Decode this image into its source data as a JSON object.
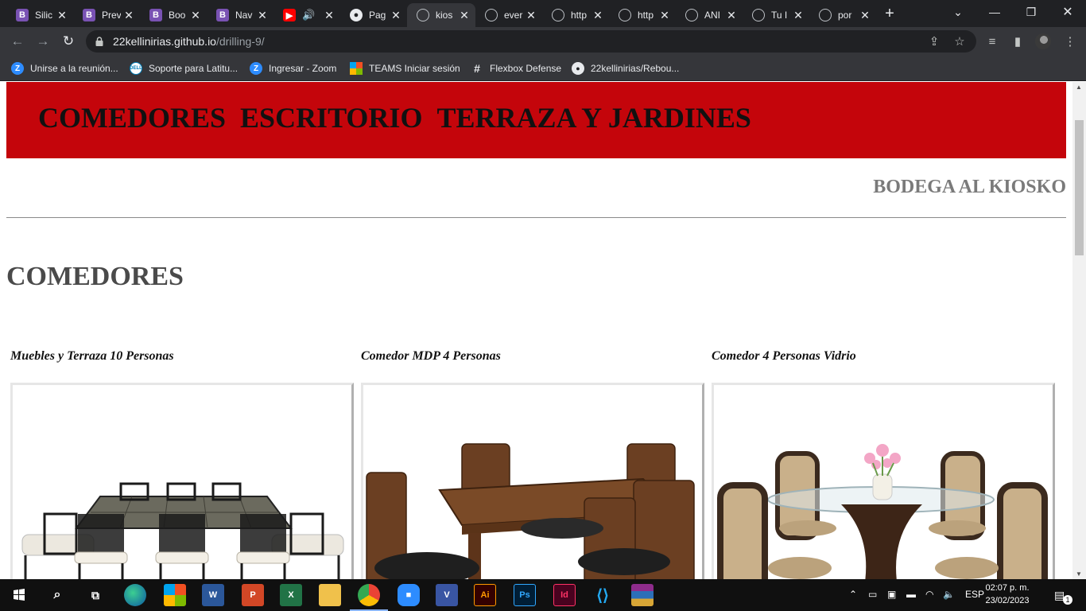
{
  "browser": {
    "tabs": [
      {
        "title": "Silic",
        "icon": "bootstrap-icon"
      },
      {
        "title": "Prev",
        "icon": "bootstrap-icon"
      },
      {
        "title": "Boo",
        "icon": "bootstrap-icon"
      },
      {
        "title": "Nav",
        "icon": "bootstrap-icon"
      },
      {
        "title": "",
        "icon": "youtube-icon",
        "audio": true
      },
      {
        "title": "Pag",
        "icon": "github-icon"
      },
      {
        "title": "kios",
        "icon": "globe-icon",
        "active": true
      },
      {
        "title": "ever",
        "icon": "globe-icon"
      },
      {
        "title": "http",
        "icon": "globe-icon"
      },
      {
        "title": "http",
        "icon": "globe-icon"
      },
      {
        "title": "ANI",
        "icon": "globe-icon"
      },
      {
        "title": "Tu I",
        "icon": "globe-icon"
      },
      {
        "title": "por",
        "icon": "globe-icon"
      }
    ],
    "url_host": "22kellinirias.github.io",
    "url_path": "/drilling-9/",
    "bookmarks": [
      {
        "label": "Unirse a la reunión...",
        "icon": "zoom-icon"
      },
      {
        "label": "Soporte para Latitu...",
        "icon": "dell-icon"
      },
      {
        "label": "Ingresar - Zoom",
        "icon": "zoom-icon"
      },
      {
        "label": "TEAMS Iniciar sesión",
        "icon": "microsoft-icon"
      },
      {
        "label": "Flexbox Defense",
        "icon": "hash-icon"
      },
      {
        "label": "22kellinirias/Rebou...",
        "icon": "github-icon"
      }
    ]
  },
  "page": {
    "nav": [
      "COMEDORES",
      "ESCRITORIO",
      "TERRAZA Y JARDINES"
    ],
    "brand": "BODEGA AL KIOSKO",
    "section_title": "COMEDORES",
    "products": [
      {
        "name": "Muebles y Terraza 10 Personas"
      },
      {
        "name": "Comedor MDP 4 Personas"
      },
      {
        "name": "Comedor 4 Personas Vidrio"
      }
    ],
    "colors": {
      "header_bg": "#c4050b",
      "brand_text": "#7a7a7a",
      "section_text": "#4a4a4a"
    }
  },
  "taskbar": {
    "language": "ESP",
    "time": "02:07 p. m.",
    "date": "23/02/2023",
    "notifications": "1",
    "apps": [
      "start-icon",
      "search-icon",
      "task-view-icon",
      "edge-icon",
      "store-icon",
      "word-icon",
      "powerpoint-icon",
      "excel-icon",
      "file-explorer-icon",
      "chrome-icon",
      "zoom-icon",
      "visio-icon",
      "illustrator-icon",
      "photoshop-icon",
      "indesign-icon",
      "vscode-icon",
      "winrar-icon"
    ],
    "app_letters": {
      "word": "W",
      "powerpoint": "P",
      "excel": "X",
      "visio": "V",
      "illustrator": "Ai",
      "photoshop": "Ps",
      "indesign": "Id"
    }
  }
}
